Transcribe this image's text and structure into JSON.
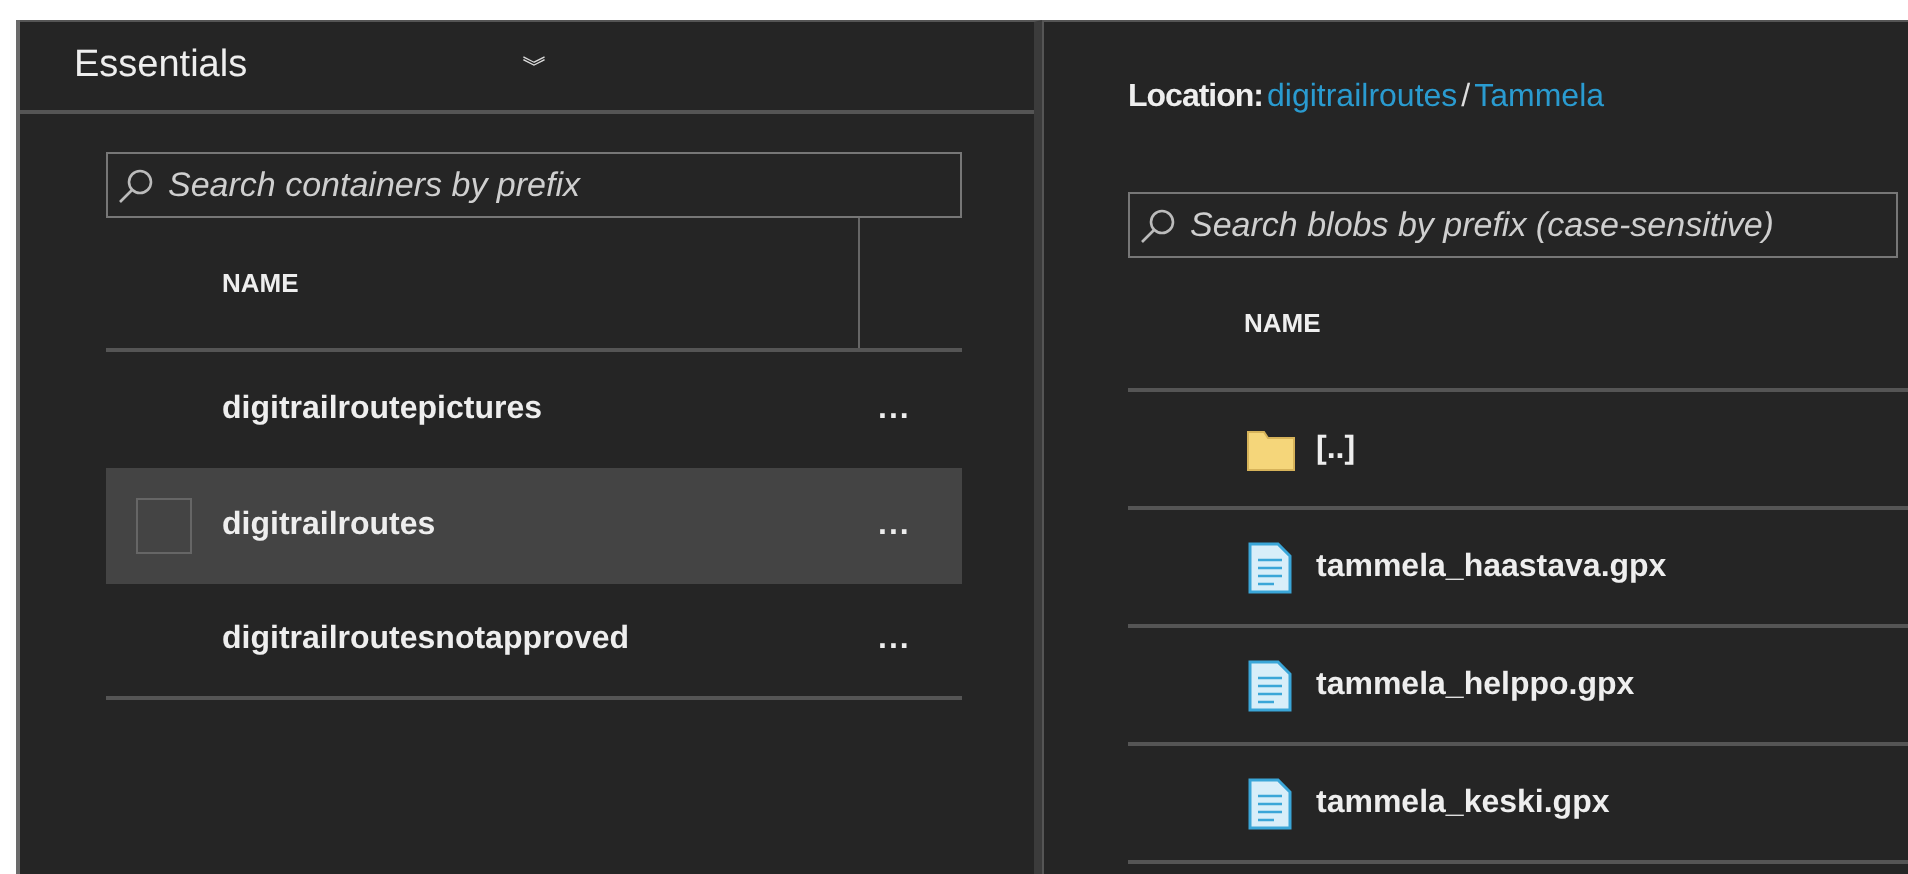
{
  "left_panel": {
    "title": "Essentials",
    "collapse_icon": "︾",
    "search": {
      "placeholder": "Search containers by prefix"
    },
    "table": {
      "columns": [
        "NAME"
      ],
      "rows": [
        {
          "name": "digitrailroutepictures",
          "selected": false,
          "menu": "..."
        },
        {
          "name": "digitrailroutes",
          "selected": true,
          "menu": "..."
        },
        {
          "name": "digitrailroutesnotapproved",
          "selected": false,
          "menu": "..."
        }
      ]
    }
  },
  "right_panel": {
    "location_label": "Location:",
    "breadcrumb": [
      "digitrailroutes",
      "Tammela"
    ],
    "separator": "/",
    "search": {
      "placeholder": "Search blobs by prefix (case-sensitive)"
    },
    "table": {
      "columns": [
        "NAME"
      ],
      "rows": [
        {
          "kind": "folder",
          "name": "[..]"
        },
        {
          "kind": "file",
          "name": "tammela_haastava.gpx"
        },
        {
          "kind": "file",
          "name": "tammela_helppo.gpx"
        },
        {
          "kind": "file",
          "name": "tammela_keski.gpx"
        }
      ]
    }
  }
}
